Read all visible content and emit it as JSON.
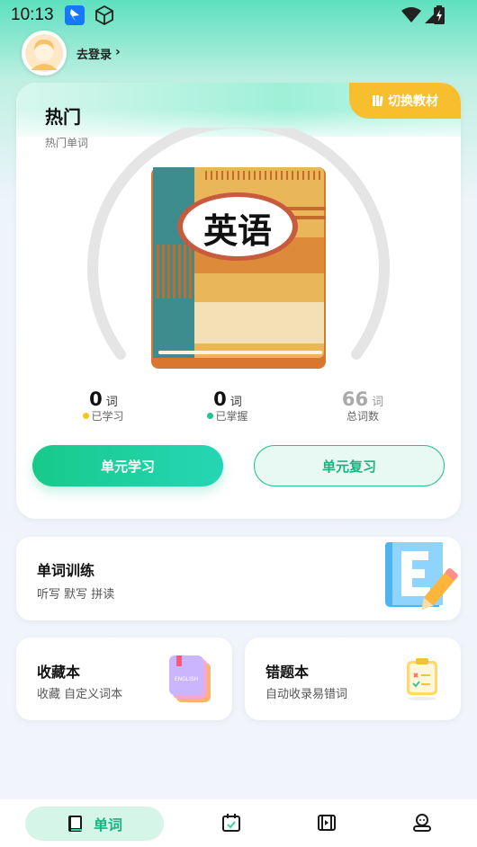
{
  "status_bar": {
    "time": "10:13",
    "icons": [
      "app-icon",
      "cube-icon",
      "wifi-icon",
      "cell-signal-icon",
      "battery-icon"
    ]
  },
  "header": {
    "login_text": "去登录",
    "chevron": "›"
  },
  "main_card": {
    "switch_label": "切换教材",
    "title": "热门",
    "subtitle": "热门单词",
    "book_title": "英语",
    "stats": [
      {
        "value": "0",
        "unit": "词",
        "label": "已学习",
        "dot_color": "#f5c518"
      },
      {
        "value": "0",
        "unit": "词",
        "label": "已掌握",
        "dot_color": "#22c493"
      },
      {
        "value": "66",
        "unit": "词",
        "label": "总词数"
      }
    ],
    "learn_button": "单元学习",
    "review_button": "单元复习"
  },
  "training_card": {
    "title": "单词训练",
    "subtitle": "听写 默写 拼读"
  },
  "favorites_card": {
    "title": "收藏本",
    "subtitle": "收藏 自定义词本",
    "book_label": "ENGLISH"
  },
  "errors_card": {
    "title": "错题本",
    "subtitle": "自动收录易错词"
  },
  "bottom_nav": {
    "items": [
      {
        "label": "单词",
        "icon": "book-icon",
        "active": true
      },
      {
        "label": "",
        "icon": "calendar-icon",
        "active": false
      },
      {
        "label": "",
        "icon": "video-icon",
        "active": false
      },
      {
        "label": "",
        "icon": "user-icon",
        "active": false
      }
    ]
  },
  "colors": {
    "accent": "#22c493",
    "switch_bg": "#f7be2e",
    "dot_learned": "#f5c518",
    "dot_mastered": "#22c493"
  }
}
